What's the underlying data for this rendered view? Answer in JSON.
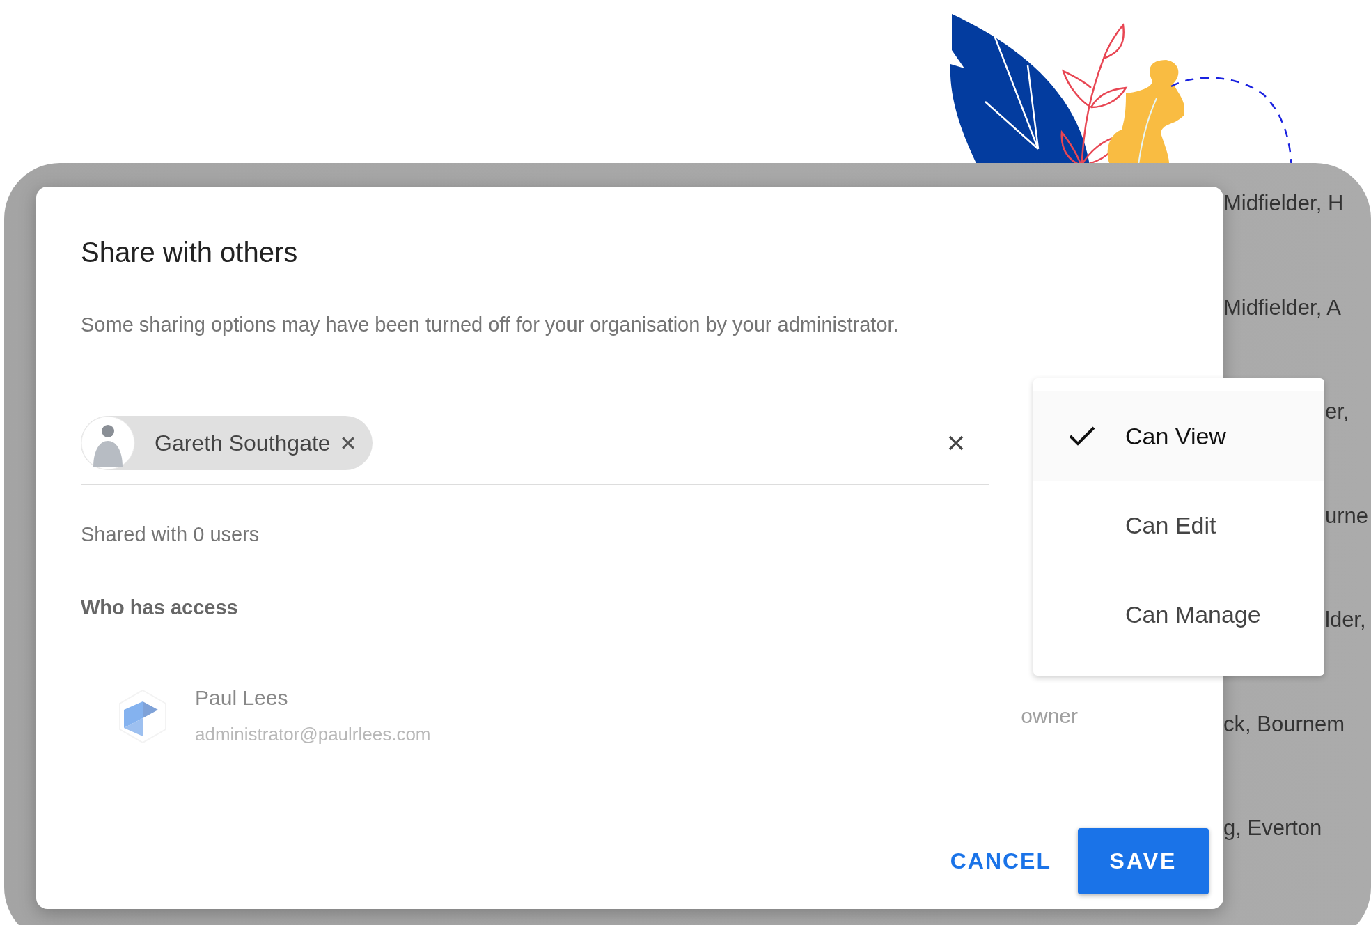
{
  "dialog": {
    "title": "Share with others",
    "subtitle": "Some sharing options may have been turned off for your organisation by your administrator.",
    "recipients": [
      {
        "name": "Gareth Southgate"
      }
    ],
    "shared_count": "Shared with 0 users",
    "access_heading": "Who has access",
    "people": [
      {
        "name": "Paul Lees",
        "email": "administrator@paulrlees.com",
        "role": "owner"
      }
    ],
    "buttons": [
      {
        "label": "CANCEL",
        "kind": "text"
      },
      {
        "label": "SAVE",
        "kind": "filled"
      }
    ]
  },
  "permission_menu": {
    "items": [
      {
        "label": "Can View",
        "selected": true
      },
      {
        "label": "Can Edit",
        "selected": false
      },
      {
        "label": "Can Manage",
        "selected": false
      }
    ]
  },
  "background_list": [
    "Midfielder, H",
    "Midfielder, A",
    "er,",
    "urne",
    "lder,",
    "ck, Bournem",
    "g, Everton"
  ]
}
